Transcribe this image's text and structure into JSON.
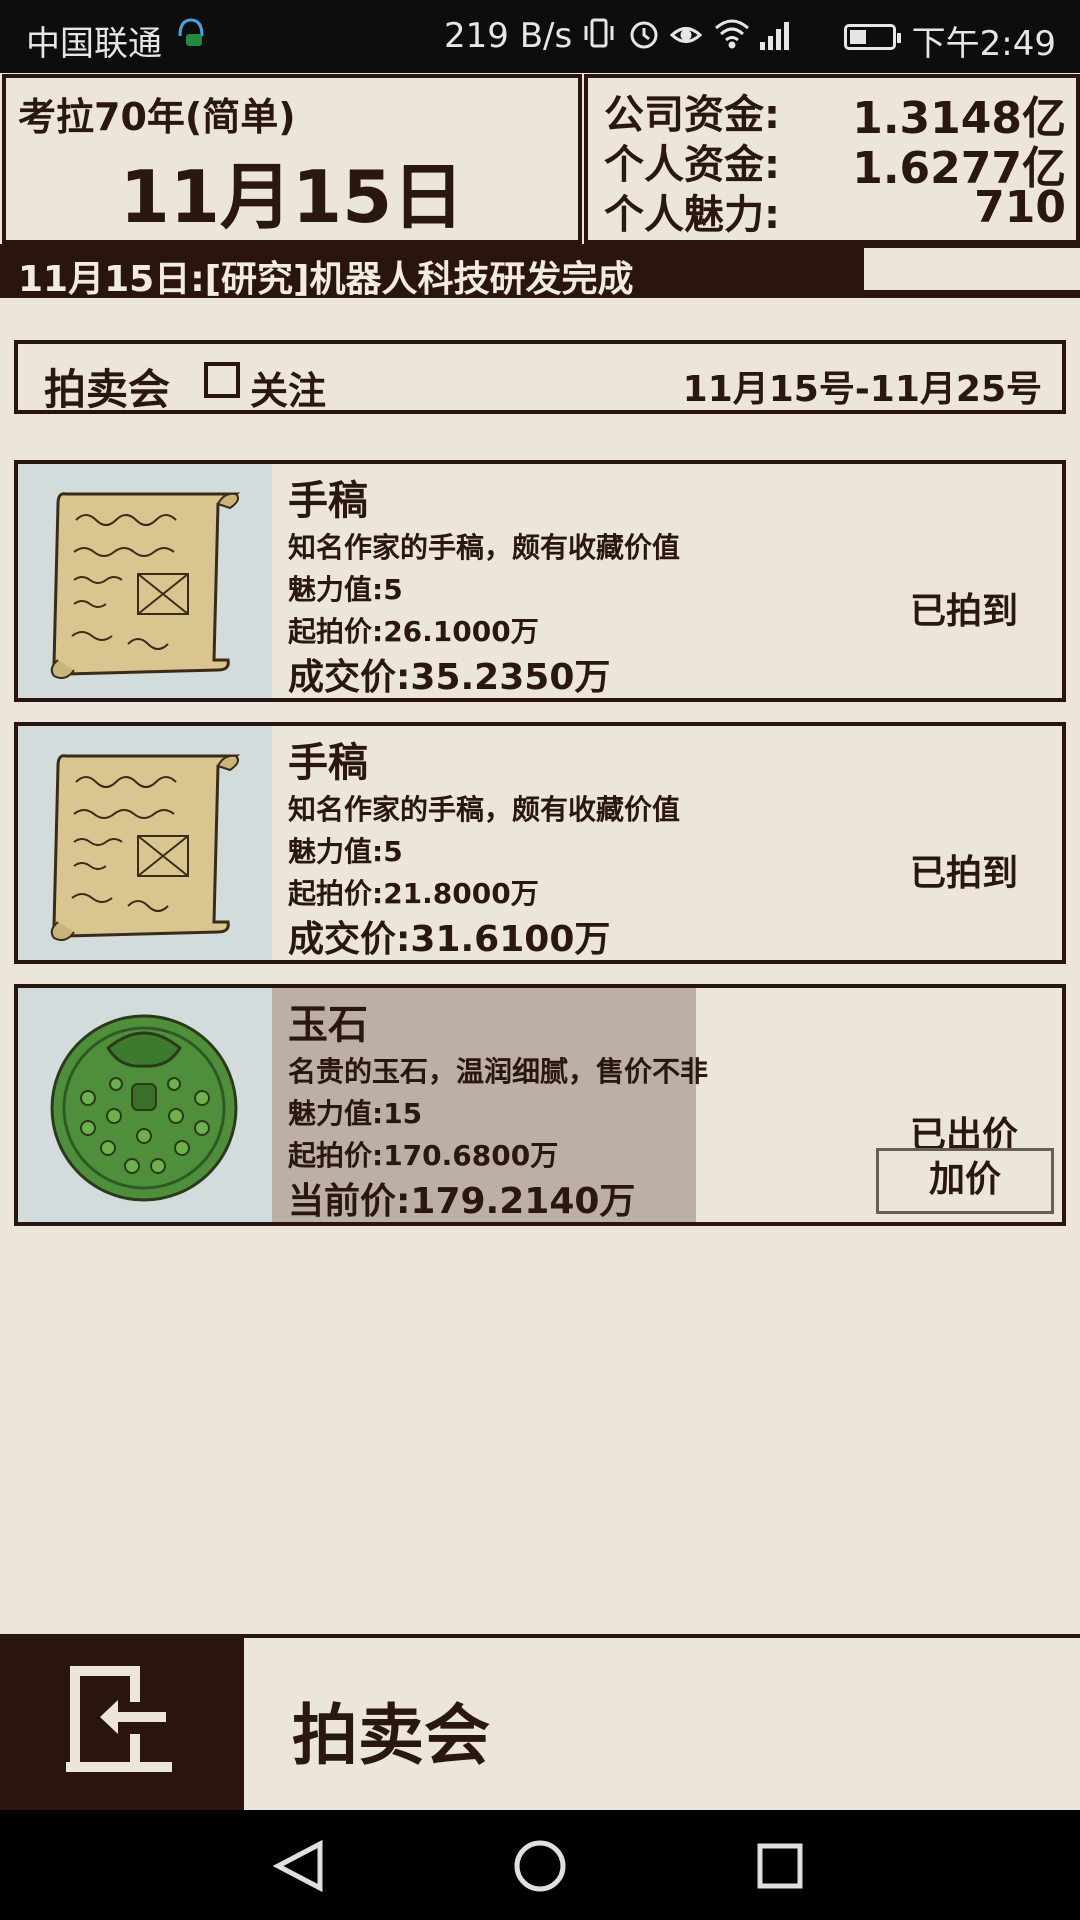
{
  "status_bar": {
    "carrier": "中国联通",
    "speed": "219 B/s",
    "time": "下午2:49",
    "icons": [
      "vibrate-icon",
      "alarm-icon",
      "eye-icon",
      "wifi-icon",
      "signal-icon",
      "battery-icon"
    ]
  },
  "header": {
    "game_title": "考拉70年(简单)",
    "date": "11月15日",
    "stats": [
      {
        "label": "公司资金:",
        "value": "1.3148亿"
      },
      {
        "label": "个人资金:",
        "value": "1.6277亿"
      },
      {
        "label": "个人魅力:",
        "value": "710"
      }
    ]
  },
  "news": {
    "text": "11月15日:[研究]机器人科技研发完成"
  },
  "auction": {
    "title": "拍卖会",
    "follow_label": "关注",
    "follow_checked": false,
    "period": "11月15号-11月25号"
  },
  "items": [
    {
      "name": "手稿",
      "description": "知名作家的手稿，颇有收藏价值",
      "charm": "魅力值:5",
      "start_price": "起拍价:26.1000万",
      "price": "成交价:35.2350万",
      "status": "已拍到",
      "icon": "manuscript-icon"
    },
    {
      "name": "手稿",
      "description": "知名作家的手稿，颇有收藏价值",
      "charm": "魅力值:5",
      "start_price": "起拍价:21.8000万",
      "price": "成交价:31.6100万",
      "status": "已拍到",
      "icon": "manuscript-icon"
    },
    {
      "name": "玉石",
      "description": "名贵的玉石，温润细腻，售价不非",
      "charm": "魅力值:15",
      "start_price": "起拍价:170.6800万",
      "price": "当前价:179.2140万",
      "status": "已出价",
      "button": "加价",
      "icon": "jade-icon"
    }
  ],
  "footer": {
    "page_label": "拍卖会",
    "back_icon": "exit-icon"
  },
  "nav_bar": {
    "icons": [
      "back-triangle-icon",
      "home-circle-icon",
      "recents-square-icon"
    ]
  },
  "colors": {
    "background": "#ece6da",
    "dark": "#2a1410",
    "image_bg": "#d2dcdc",
    "jade": "#4a8a3a"
  }
}
